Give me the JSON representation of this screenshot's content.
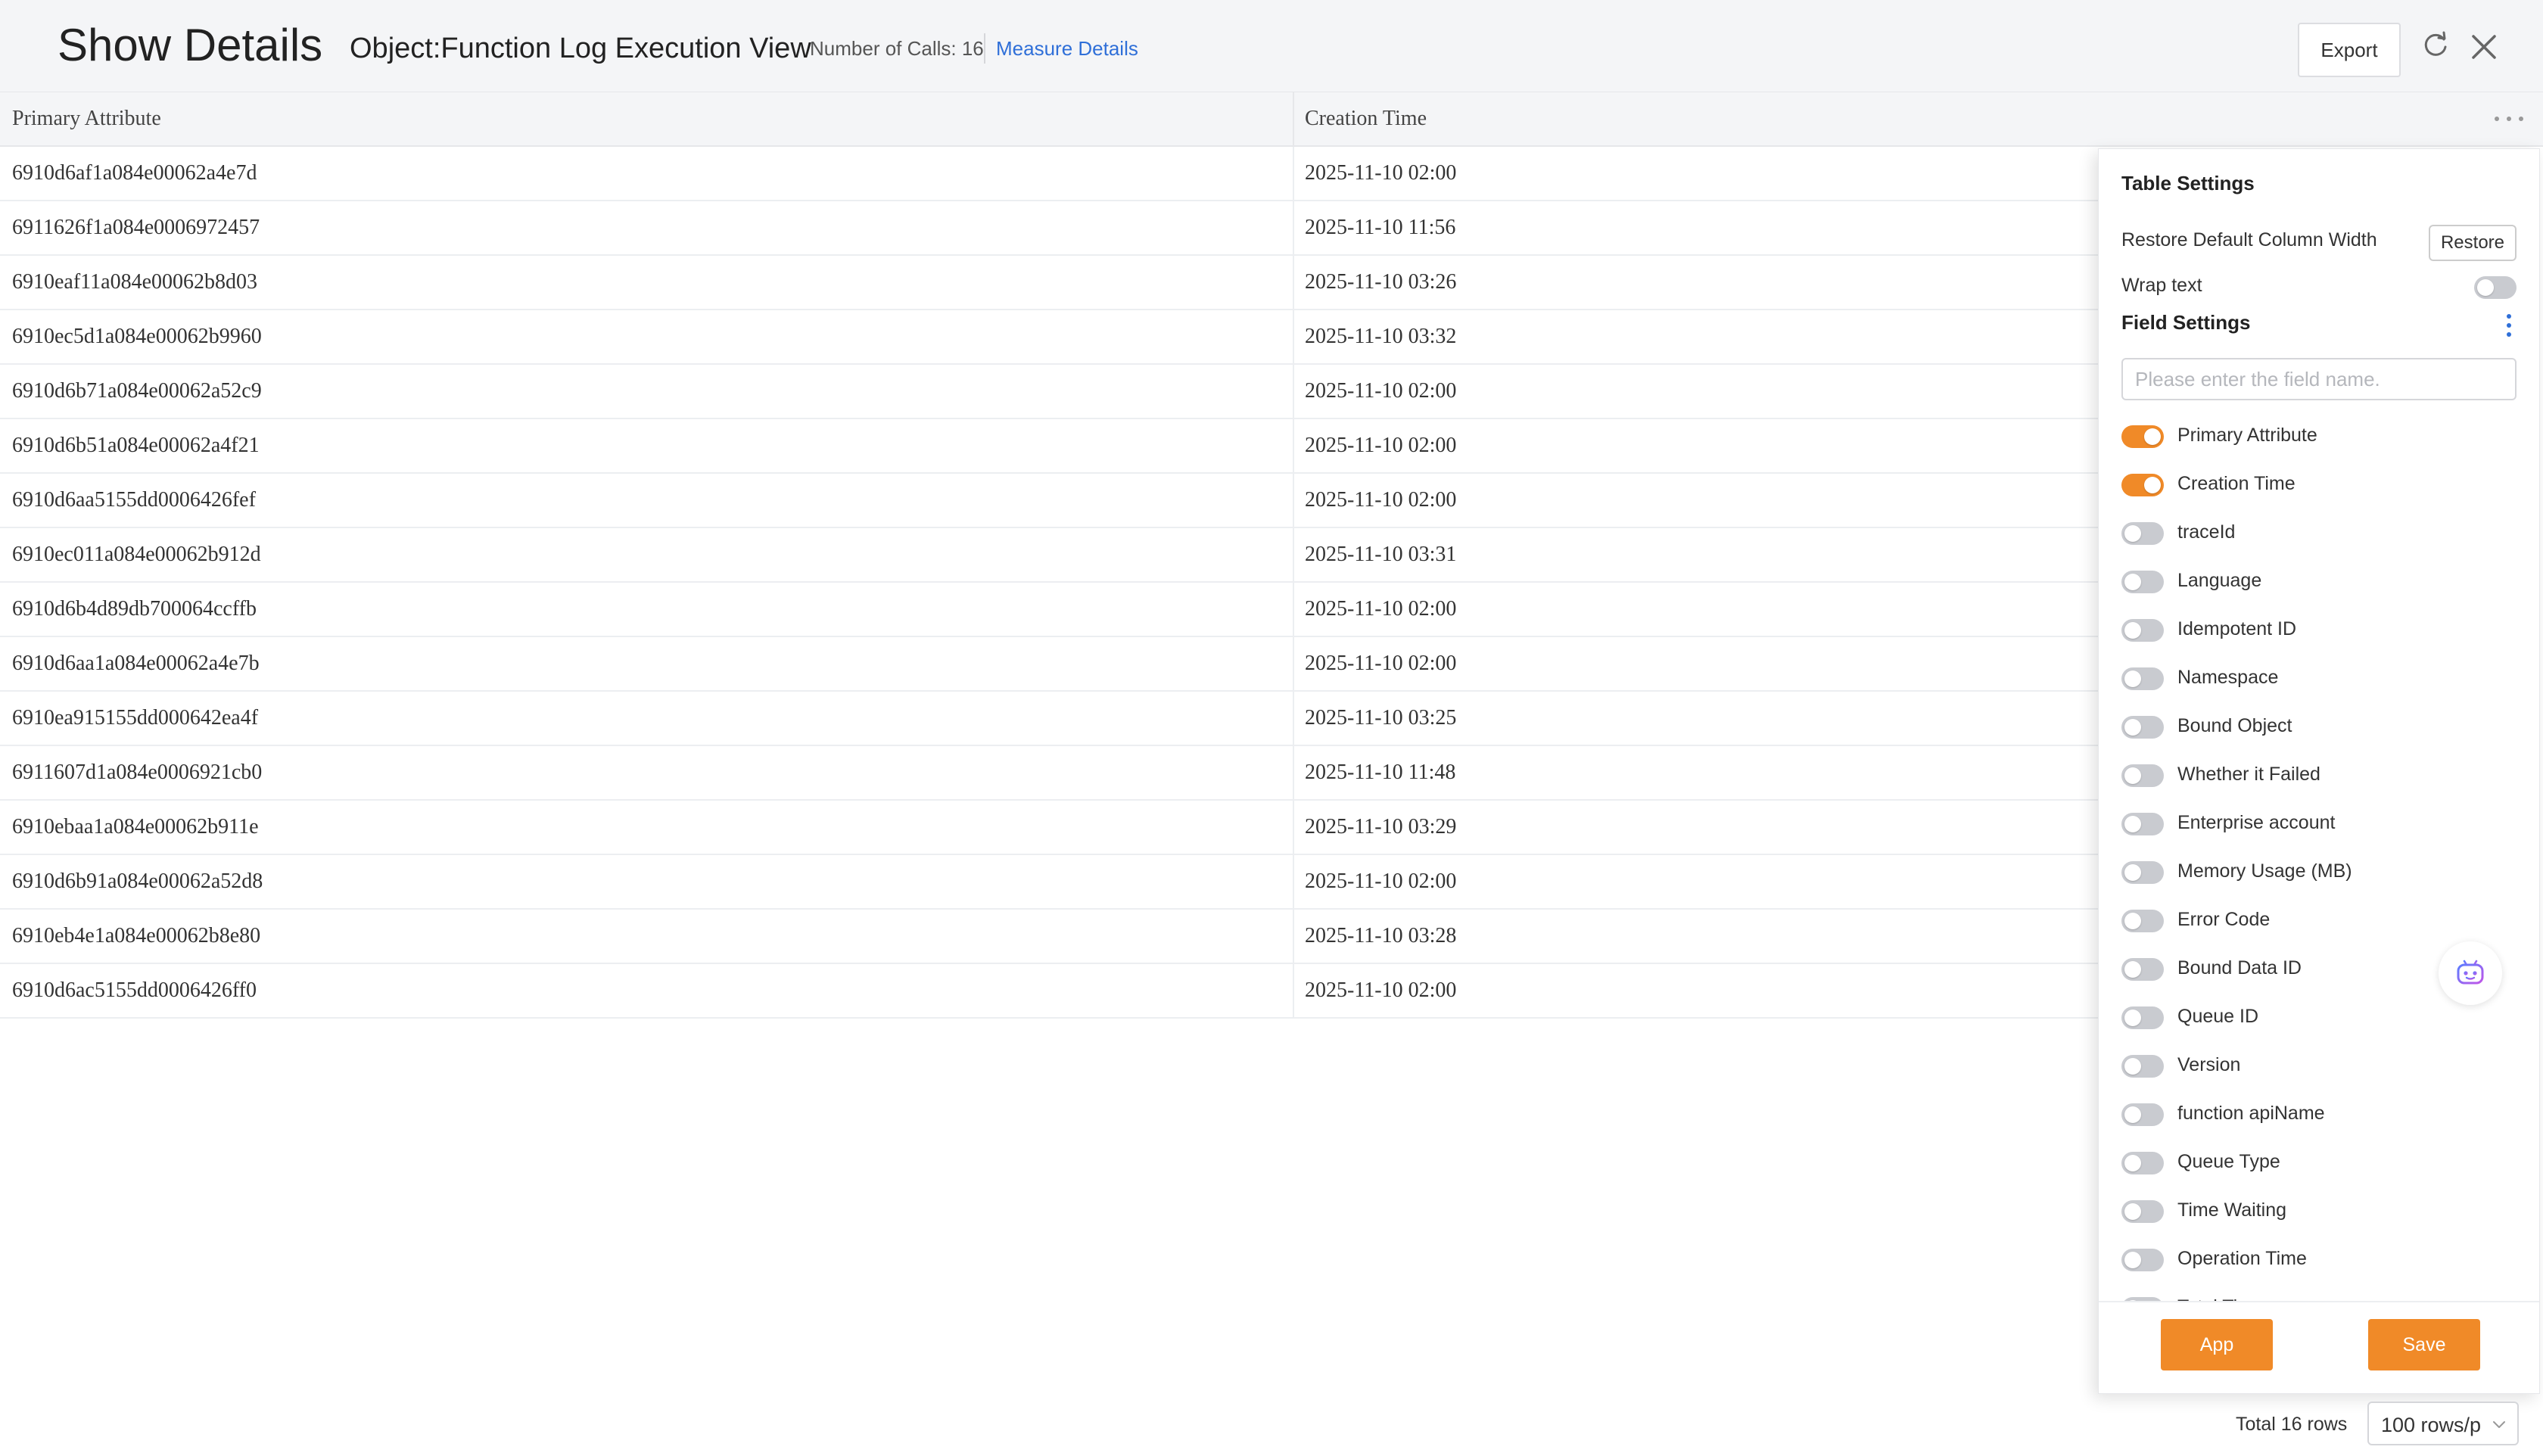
{
  "header": {
    "title": "Show Details",
    "view_title": "Object:Function Log Execution View",
    "calls_count": "Number of Calls: 16",
    "measure_link": "Measure Details",
    "export_label": "Export",
    "refresh_icon": "refresh-icon",
    "close_icon": "close-icon"
  },
  "table": {
    "columns": [
      "Primary Attribute",
      "Creation Time"
    ],
    "rows": [
      [
        "6910d6af1a084e00062a4e7d",
        "2025-11-10 02:00"
      ],
      [
        "6911626f1a084e0006972457",
        "2025-11-10 11:56"
      ],
      [
        "6910eaf11a084e00062b8d03",
        "2025-11-10 03:26"
      ],
      [
        "6910ec5d1a084e00062b9960",
        "2025-11-10 03:32"
      ],
      [
        "6910d6b71a084e00062a52c9",
        "2025-11-10 02:00"
      ],
      [
        "6910d6b51a084e00062a4f21",
        "2025-11-10 02:00"
      ],
      [
        "6910d6aa5155dd0006426fef",
        "2025-11-10 02:00"
      ],
      [
        "6910ec011a084e00062b912d",
        "2025-11-10 03:31"
      ],
      [
        "6910d6b4d89db700064ccffb",
        "2025-11-10 02:00"
      ],
      [
        "6910d6aa1a084e00062a4e7b",
        "2025-11-10 02:00"
      ],
      [
        "6910ea915155dd000642ea4f",
        "2025-11-10 03:25"
      ],
      [
        "6911607d1a084e0006921cb0",
        "2025-11-10 11:48"
      ],
      [
        "6910ebaa1a084e00062b911e",
        "2025-11-10 03:29"
      ],
      [
        "6910d6b91a084e00062a52d8",
        "2025-11-10 02:00"
      ],
      [
        "6910eb4e1a084e00062b8e80",
        "2025-11-10 03:28"
      ],
      [
        "6910d6ac5155dd0006426ff0",
        "2025-11-10 02:00"
      ]
    ]
  },
  "settings": {
    "title": "Table Settings",
    "restore_label": "Restore Default Column Width",
    "restore_button": "Restore",
    "wrap_label": "Wrap text",
    "wrap_enabled": false,
    "field_settings_title": "Field Settings",
    "search_placeholder": "Please enter the field name.",
    "fields": [
      {
        "label": "Primary Attribute",
        "enabled": true
      },
      {
        "label": "Creation Time",
        "enabled": true
      },
      {
        "label": "traceId",
        "enabled": false
      },
      {
        "label": "Language",
        "enabled": false
      },
      {
        "label": "Idempotent ID",
        "enabled": false
      },
      {
        "label": "Namespace",
        "enabled": false
      },
      {
        "label": "Bound Object",
        "enabled": false
      },
      {
        "label": "Whether it Failed",
        "enabled": false
      },
      {
        "label": "Enterprise account",
        "enabled": false
      },
      {
        "label": "Memory Usage (MB)",
        "enabled": false
      },
      {
        "label": "Error Code",
        "enabled": false
      },
      {
        "label": "Bound Data ID",
        "enabled": false
      },
      {
        "label": "Queue ID",
        "enabled": false
      },
      {
        "label": "Version",
        "enabled": false
      },
      {
        "label": "function apiName",
        "enabled": false
      },
      {
        "label": "Queue Type",
        "enabled": false
      },
      {
        "label": "Time Waiting",
        "enabled": false
      },
      {
        "label": "Operation Time",
        "enabled": false
      },
      {
        "label": "Total Time",
        "enabled": false
      }
    ],
    "app_button": "App",
    "save_button": "Save"
  },
  "footer": {
    "total_rows": "Total 16 rows",
    "page_size": "100 rows/p"
  },
  "colors": {
    "accent": "#f08a28",
    "link": "#2f6fd8"
  }
}
